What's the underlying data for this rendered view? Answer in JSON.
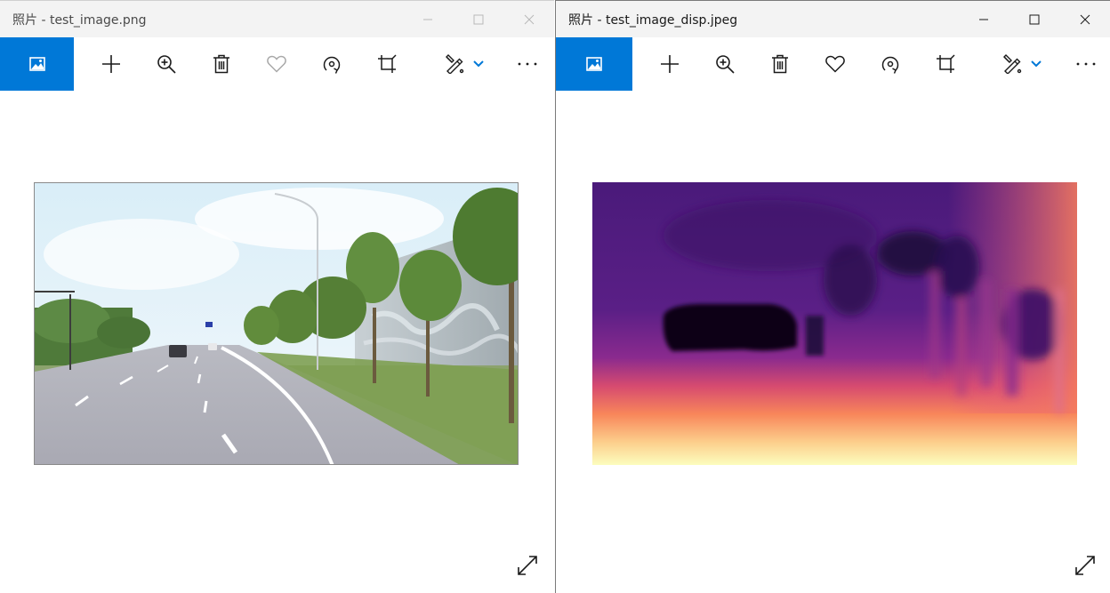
{
  "windows": [
    {
      "id": "left",
      "title": "照片 - test_image.png",
      "state": "inactive",
      "photo_description": "road scene",
      "toolbar": {
        "home_icon": "photo-icon",
        "tools": [
          "add-icon",
          "zoom-in-icon",
          "delete-icon",
          "favorite-icon",
          "rotate-icon",
          "crop-icon",
          "edit-draw-icon",
          "chevron-down-icon",
          "more-icon"
        ],
        "favorite_disabled": true
      }
    },
    {
      "id": "right",
      "title": "照片 - test_image_disp.jpeg",
      "state": "active",
      "photo_description": "disparity map",
      "toolbar": {
        "home_icon": "photo-icon",
        "tools": [
          "add-icon",
          "zoom-in-icon",
          "delete-icon",
          "favorite-icon",
          "rotate-icon",
          "crop-icon",
          "edit-draw-icon",
          "chevron-down-icon",
          "more-icon"
        ],
        "favorite_disabled": false
      }
    }
  ],
  "colors": {
    "accent": "#0078d7",
    "titlebar": "#f3f3f3",
    "taskbar_strip": "#c42b1c"
  }
}
